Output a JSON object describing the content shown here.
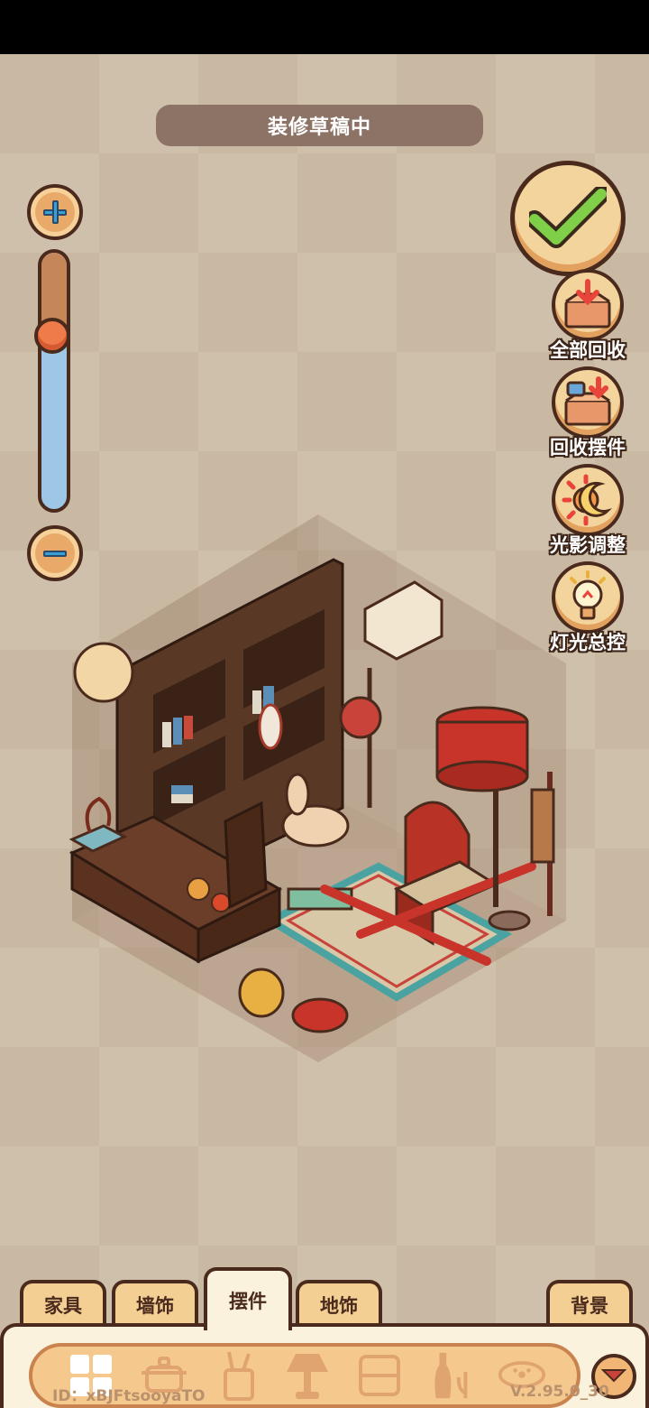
{
  "banner": {
    "text": "装修草稿中"
  },
  "zoom": {
    "level": 0.33
  },
  "side_buttons": [
    {
      "label": "全部回收",
      "icon": "box-recycle-all-icon"
    },
    {
      "label": "回收摆件",
      "icon": "box-recycle-ornament-icon"
    },
    {
      "label": "光影调整",
      "icon": "sun-moon-icon"
    },
    {
      "label": "灯光总控",
      "icon": "lightbulb-icon"
    }
  ],
  "tabs": [
    {
      "label": "家具"
    },
    {
      "label": "墙饰"
    },
    {
      "label": "摆件",
      "active": true
    },
    {
      "label": "地饰"
    },
    {
      "label": "背景"
    }
  ],
  "categories": [
    "grid-all-icon",
    "pot-icon",
    "brush-holder-icon",
    "lamp-icon",
    "screen-icon",
    "vase-icon",
    "pet-bowl-icon"
  ],
  "footer": {
    "id_text": "ID：xBJFtsooyaTO",
    "version": "V.2.95.0_30"
  },
  "colors": {
    "outline": "#4a2a1c",
    "button_face": "#f3d49d",
    "banner_bg": "#8d7266",
    "confirm_check": "#7fcf48"
  }
}
